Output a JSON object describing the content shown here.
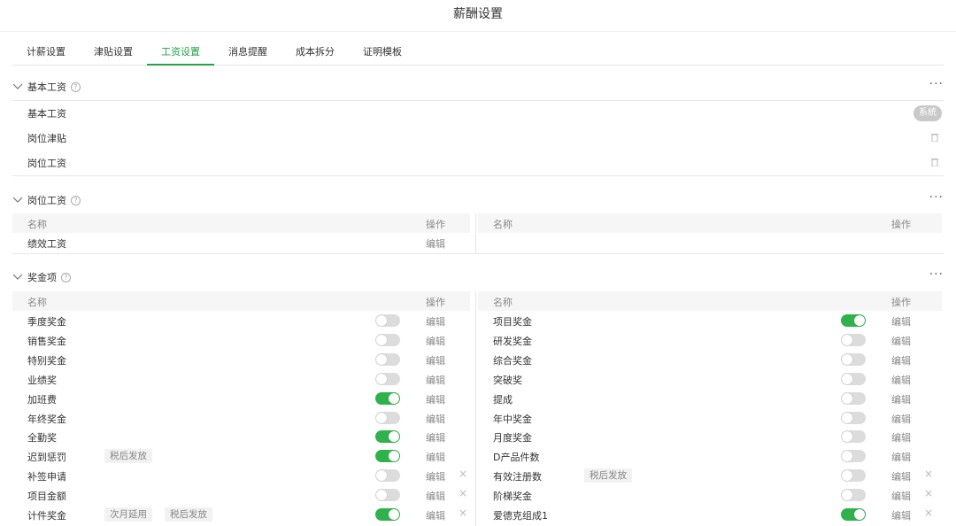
{
  "title": "薪酬设置",
  "tabs": [
    {
      "label": "计薪设置",
      "active": false
    },
    {
      "label": "津贴设置",
      "active": false
    },
    {
      "label": "工资设置",
      "active": true
    },
    {
      "label": "消息提醒",
      "active": false
    },
    {
      "label": "成本拆分",
      "active": false
    },
    {
      "label": "证明模板",
      "active": false
    }
  ],
  "colors": {
    "accent": "#22a34a",
    "toggle_on": "#2fb24c",
    "toggle_off": "#dcdcdc"
  },
  "basic_section": {
    "title": "基本工资",
    "rows": [
      {
        "name": "基本工资",
        "badge": "系統"
      },
      {
        "name": "岗位津贴"
      },
      {
        "name": "岗位工资"
      }
    ]
  },
  "position_section": {
    "title": "岗位工资",
    "col_name": "名称",
    "col_op": "操作",
    "rows": [
      {
        "name": "绩效工资",
        "edit": "编辑"
      }
    ]
  },
  "bonus_section": {
    "title": "奖金项",
    "col_name": "名称",
    "col_op": "操作",
    "edit_label": "编辑",
    "left": [
      {
        "name": "季度奖金",
        "on": false,
        "tags": [],
        "deletable": false
      },
      {
        "name": "销售奖金",
        "on": false,
        "tags": [],
        "deletable": false
      },
      {
        "name": "特别奖金",
        "on": false,
        "tags": [],
        "deletable": false
      },
      {
        "name": "业绩奖",
        "on": false,
        "tags": [],
        "deletable": false
      },
      {
        "name": "加班费",
        "on": true,
        "tags": [],
        "deletable": false
      },
      {
        "name": "年终奖金",
        "on": false,
        "tags": [],
        "deletable": false
      },
      {
        "name": "全勤奖",
        "on": true,
        "tags": [],
        "deletable": false
      },
      {
        "name": "迟到惩罚",
        "on": true,
        "tags": [
          "税后发放"
        ],
        "deletable": false
      },
      {
        "name": "补签申请",
        "on": false,
        "tags": [],
        "deletable": true
      },
      {
        "name": "项目金额",
        "on": false,
        "tags": [],
        "deletable": true
      },
      {
        "name": "计件奖金",
        "on": true,
        "tags": [
          "次月延用",
          "税后发放"
        ],
        "deletable": true
      }
    ],
    "right": [
      {
        "name": "项目奖金",
        "on": true,
        "tags": [],
        "deletable": false
      },
      {
        "name": "研发奖金",
        "on": false,
        "tags": [],
        "deletable": false
      },
      {
        "name": "综合奖金",
        "on": false,
        "tags": [],
        "deletable": false
      },
      {
        "name": "突破奖",
        "on": false,
        "tags": [],
        "deletable": false
      },
      {
        "name": "提成",
        "on": false,
        "tags": [],
        "deletable": false
      },
      {
        "name": "年中奖金",
        "on": false,
        "tags": [],
        "deletable": false
      },
      {
        "name": "月度奖金",
        "on": false,
        "tags": [],
        "deletable": false
      },
      {
        "name": "D产品件数",
        "on": false,
        "tags": [],
        "deletable": false
      },
      {
        "name": "有效注册数",
        "on": false,
        "tags": [
          "税后发放"
        ],
        "deletable": true
      },
      {
        "name": "阶梯奖金",
        "on": false,
        "tags": [],
        "deletable": true
      },
      {
        "name": "爱德克组成1",
        "on": true,
        "tags": [],
        "deletable": true
      }
    ]
  }
}
